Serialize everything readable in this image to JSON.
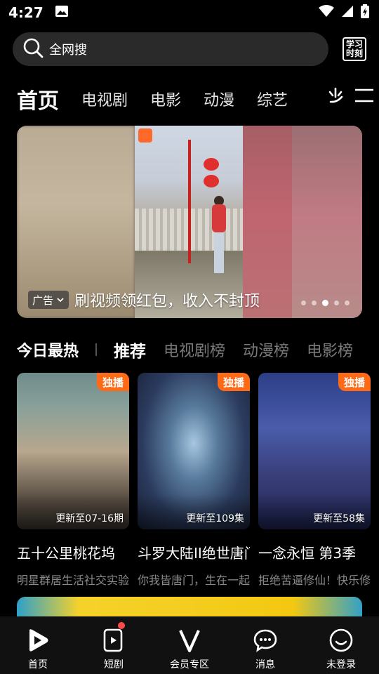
{
  "status": {
    "time": "4:27"
  },
  "search": {
    "placeholder": "全网搜",
    "xuexi_line1": "学习",
    "xuexi_line2": "时刻"
  },
  "tabs": [
    "首页",
    "电视剧",
    "电影",
    "动漫",
    "综艺"
  ],
  "banner": {
    "ad_tag": "广告",
    "title": "刷视频领红包，收入不封顶",
    "carousel": {
      "count": 5,
      "active_index": 2
    }
  },
  "ranking": {
    "heading": "今日最热",
    "tabs": [
      "推荐",
      "电视剧榜",
      "动漫榜",
      "电影榜"
    ]
  },
  "cards": [
    {
      "badge": "独播",
      "update": "更新至07-16期",
      "title": "五十公里桃花坞",
      "subtitle": "明星群居生活社交实验"
    },
    {
      "badge": "独播",
      "update": "更新至109集",
      "title": "斗罗大陆II绝世唐门",
      "subtitle": "你我皆唐门，生在一起"
    },
    {
      "badge": "独播",
      "update": "更新至58集",
      "title": "一念永恒 第3季",
      "subtitle": "拒绝苦逼修仙！快乐修仙"
    }
  ],
  "nav": [
    {
      "label": "首页",
      "icon": "play-icon"
    },
    {
      "label": "短剧",
      "icon": "short-video-icon"
    },
    {
      "label": "会员专区",
      "icon": "vip-v-icon"
    },
    {
      "label": "消息",
      "icon": "message-icon"
    },
    {
      "label": "未登录",
      "icon": "user-face-icon"
    }
  ]
}
